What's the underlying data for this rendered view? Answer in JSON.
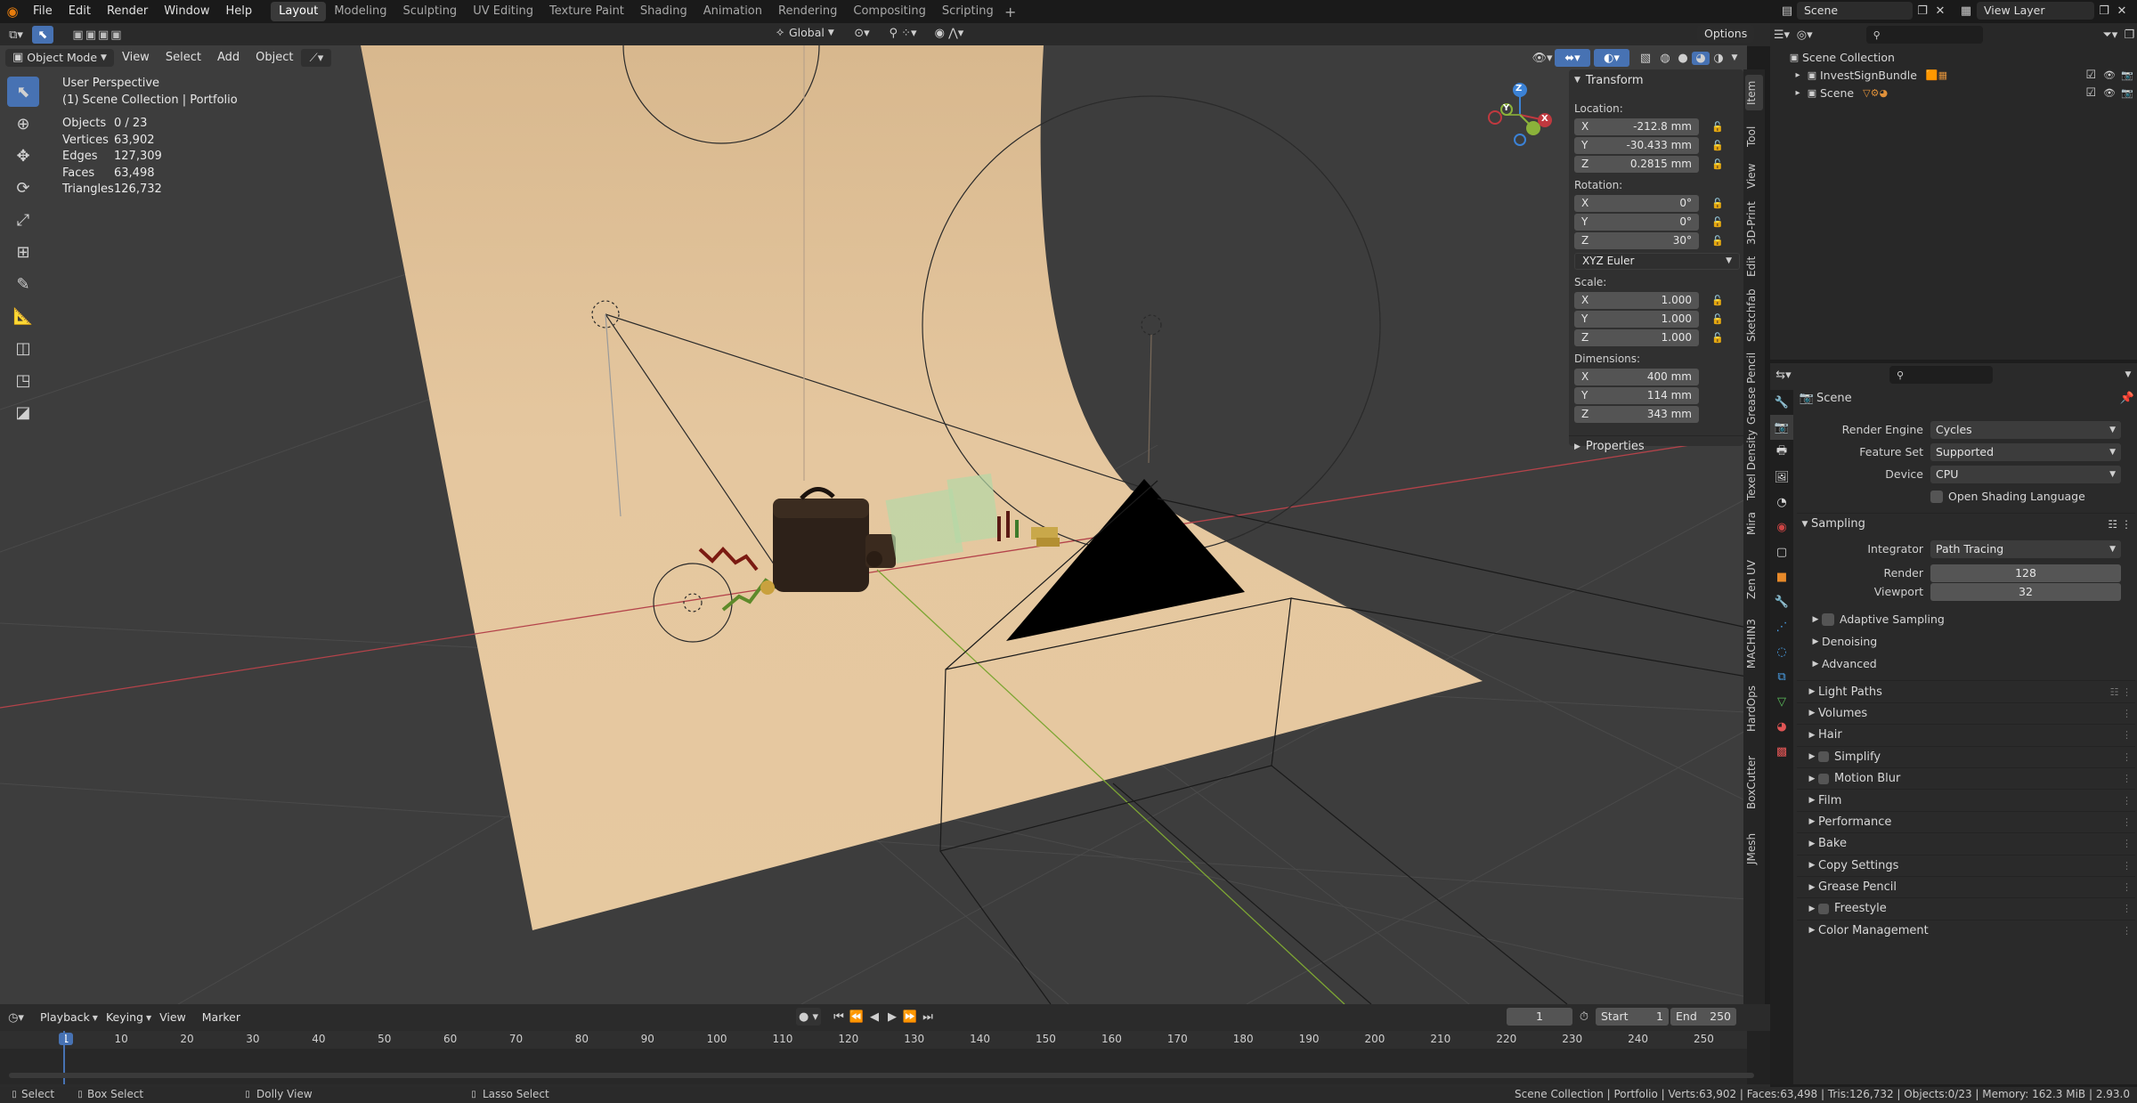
{
  "menu": {
    "file": "File",
    "edit": "Edit",
    "render": "Render",
    "window": "Window",
    "help": "Help"
  },
  "workspaces": [
    "Layout",
    "Modeling",
    "Sculpting",
    "UV Editing",
    "Texture Paint",
    "Shading",
    "Animation",
    "Rendering",
    "Compositing",
    "Scripting"
  ],
  "scene_name": "Scene",
  "view_layer": "View Layer",
  "header": {
    "transform_orientation": "Global",
    "options": "Options"
  },
  "viewport_header": {
    "mode": "Object Mode",
    "view": "View",
    "select": "Select",
    "add": "Add",
    "object": "Object"
  },
  "overlay": {
    "perspective": "User Perspective",
    "collection": "(1) Scene Collection | Portfolio",
    "stats": [
      {
        "label": "Objects",
        "value": "0 / 23"
      },
      {
        "label": "Vertices",
        "value": "63,902"
      },
      {
        "label": "Edges",
        "value": "127,309"
      },
      {
        "label": "Faces",
        "value": "63,498"
      },
      {
        "label": "Triangles",
        "value": "126,732"
      }
    ]
  },
  "gizmo": {
    "x": "X",
    "y": "Y",
    "z": "Z"
  },
  "npanel": {
    "transform_title": "Transform",
    "location_label": "Location:",
    "location": [
      {
        "axis": "X",
        "value": "-212.8 mm"
      },
      {
        "axis": "Y",
        "value": "-30.433 mm"
      },
      {
        "axis": "Z",
        "value": "0.2815 mm"
      }
    ],
    "rotation_label": "Rotation:",
    "rotation": [
      {
        "axis": "X",
        "value": "0°"
      },
      {
        "axis": "Y",
        "value": "0°"
      },
      {
        "axis": "Z",
        "value": "30°"
      }
    ],
    "rotation_mode": "XYZ Euler",
    "scale_label": "Scale:",
    "scale": [
      {
        "axis": "X",
        "value": "1.000"
      },
      {
        "axis": "Y",
        "value": "1.000"
      },
      {
        "axis": "Z",
        "value": "1.000"
      }
    ],
    "dimensions_label": "Dimensions:",
    "dimensions": [
      {
        "axis": "X",
        "value": "400 mm"
      },
      {
        "axis": "Y",
        "value": "114 mm"
      },
      {
        "axis": "Z",
        "value": "343 mm"
      }
    ],
    "properties_title": "Properties"
  },
  "sidebar_tabs": [
    "Item",
    "Tool",
    "View",
    "3D-Print",
    "Edit",
    "Sketchfab",
    "Grease Pencil",
    "Texel Density",
    "Mira",
    "Zen UV",
    "MACHIN3",
    "HardOps",
    "BoxCutter",
    "JMesh"
  ],
  "outliner": {
    "root": "Scene Collection",
    "items": [
      {
        "name": "InvestSignBundle"
      },
      {
        "name": "Scene"
      }
    ]
  },
  "properties": {
    "title": "Scene",
    "render_engine_label": "Render Engine",
    "render_engine": "Cycles",
    "feature_set_label": "Feature Set",
    "feature_set": "Supported",
    "device_label": "Device",
    "device": "CPU",
    "osl": "Open Shading Language",
    "sampling": "Sampling",
    "integrator_label": "Integrator",
    "integrator": "Path Tracing",
    "render_label": "Render",
    "render_samples": "128",
    "viewport_label": "Viewport",
    "viewport_samples": "32",
    "adaptive": "Adaptive Sampling",
    "denoising": "Denoising",
    "advanced": "Advanced",
    "sections": [
      {
        "label": "Light Paths",
        "check": false
      },
      {
        "label": "Volumes",
        "check": false
      },
      {
        "label": "Hair",
        "check": false
      },
      {
        "label": "Simplify",
        "check": true
      },
      {
        "label": "Motion Blur",
        "check": true
      },
      {
        "label": "Film",
        "check": false
      },
      {
        "label": "Performance",
        "check": false
      },
      {
        "label": "Bake",
        "check": false
      },
      {
        "label": "Copy Settings",
        "check": false
      },
      {
        "label": "Grease Pencil",
        "check": false
      },
      {
        "label": "Freestyle",
        "check": true
      },
      {
        "label": "Color Management",
        "check": false
      }
    ]
  },
  "timeline": {
    "playback": "Playback",
    "keying": "Keying",
    "view": "View",
    "marker": "Marker",
    "current_frame": "1",
    "start_label": "Start",
    "start": "1",
    "end_label": "End",
    "end": "250",
    "ruler": [
      "1",
      "10",
      "20",
      "30",
      "40",
      "50",
      "60",
      "70",
      "80",
      "90",
      "100",
      "110",
      "120",
      "130",
      "140",
      "150",
      "160",
      "170",
      "180",
      "190",
      "200",
      "210",
      "220",
      "230",
      "240",
      "250"
    ]
  },
  "status": {
    "select": "Select",
    "box_select": "Box Select",
    "dolly": "Dolly View",
    "lasso": "Lasso Select",
    "info": "Scene Collection | Portfolio | Verts:63,902 | Faces:63,498 | Tris:126,732 | Objects:0/23 | Memory: 162.3 MiB | 2.93.0"
  },
  "colors": {
    "accent": "#4772b3",
    "backdrop": "#e2c49c",
    "x_axis": "#c0393f",
    "y_axis": "#8bb23a",
    "z_axis": "#3b82d6"
  }
}
